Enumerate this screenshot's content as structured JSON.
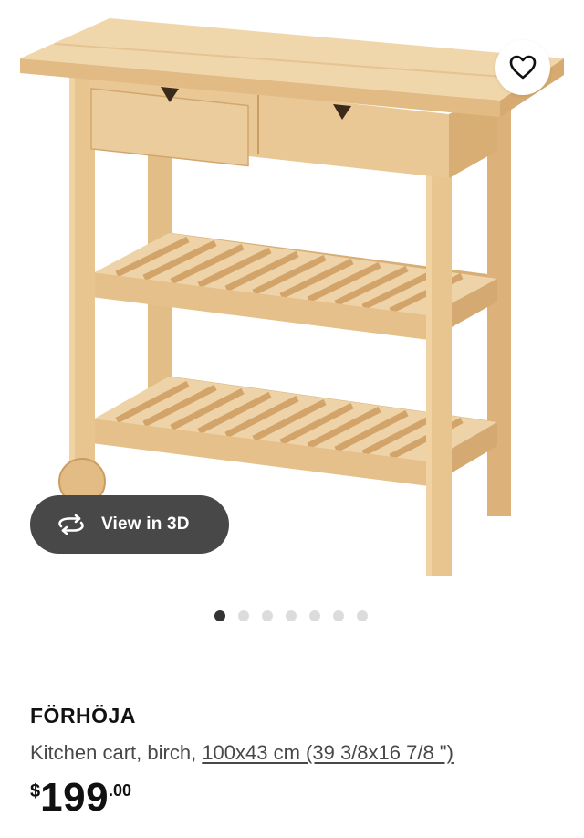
{
  "product": {
    "name": "FÖRHÖJA",
    "description": "Kitchen cart, birch, ",
    "measurement": "100x43 cm (39 3/8x16 7/8 \")",
    "price": {
      "currency": "$",
      "integer": "199",
      "decimal": ".00"
    }
  },
  "gallery": {
    "view_3d_label": "View in 3D",
    "dots": [
      {
        "active": true
      },
      {
        "active": false
      },
      {
        "active": false
      },
      {
        "active": false
      },
      {
        "active": false
      },
      {
        "active": false
      },
      {
        "active": false
      }
    ]
  },
  "icons": {
    "favorite": "heart-outline-icon",
    "view_3d": "rotate-3d-icon"
  },
  "colors": {
    "wood": "#e9c896",
    "wood_dark": "#c99c62",
    "pill_bg": "#484848",
    "dot_active": "#333333",
    "dot_inactive": "#dcdcdc"
  }
}
